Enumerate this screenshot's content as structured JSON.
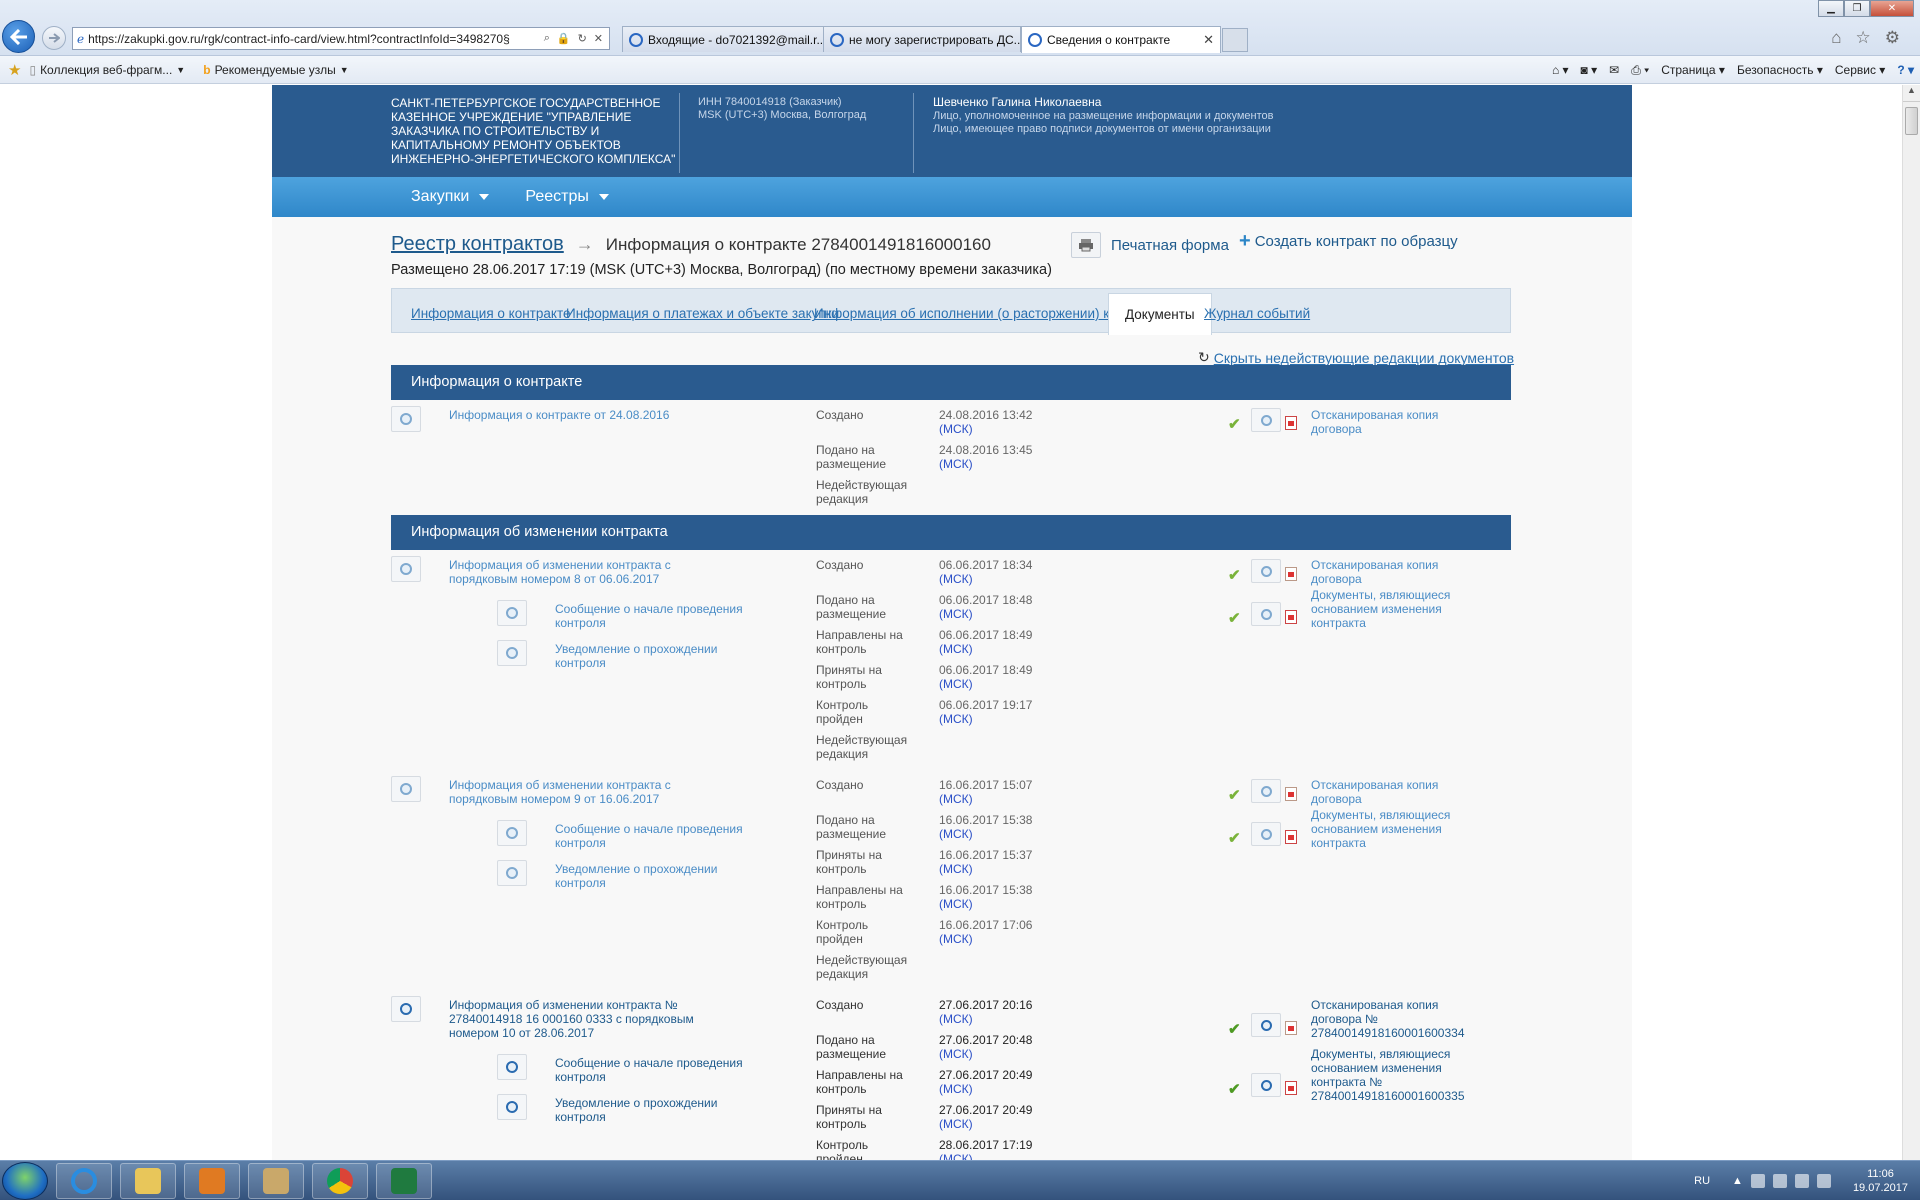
{
  "browser": {
    "address": "https://zakupki.gov.ru/rgk/contract-info-card/view.html?contractInfoId=3498270§",
    "tabs": [
      {
        "label": "Входящие - do7021392@mail.r..."
      },
      {
        "label": "не могу зарегистрировать ДС..."
      },
      {
        "label": "Сведения о контракте"
      }
    ],
    "favorites": {
      "collection": "Коллекция веб-фрагм...",
      "recommended": "Рекомендуемые узлы"
    },
    "commands": {
      "page": "Страница",
      "security": "Безопасность",
      "service": "Сервис"
    }
  },
  "header": {
    "org_name": "САНКТ-ПЕТЕРБУРГСКОЕ ГОСУДАРСТВЕННОЕ КАЗЕННОЕ УЧРЕЖДЕНИЕ \"УПРАВЛЕНИЕ ЗАКАЗЧИКА ПО СТРОИТЕЛЬСТВУ И КАПИТАЛЬНОМУ РЕМОНТУ ОБЪЕКТОВ ИНЖЕНЕРНО-ЭНЕРГЕТИЧЕСКОГО КОМПЛЕКСА\"",
    "inn": "ИНН 7840014918 (Заказчик)",
    "timezone": "MSK (UTC+3) Москва, Волгоград",
    "user_name": "Шевченко Галина Николаевна",
    "role1": "Лицо, уполномоченное на размещение информации и документов",
    "role2": "Лицо, имеющее право подписи документов от имени организации"
  },
  "menu": {
    "purchases": "Закупки",
    "registries": "Реестры"
  },
  "breadcrumb": {
    "link": "Реестр контрактов",
    "current": "Информация о контракте 2784001491816000160"
  },
  "actions": {
    "print": "Печатная форма",
    "create": "Создать контракт по образцу"
  },
  "placed": "Размещено 28.06.2017 17:19 (MSK (UTC+3) Москва, Волгоград) (по местному времени заказчика)",
  "page_tabs": {
    "info": "Информация о контракте",
    "payments": "Информация о платежах и объекте закупки",
    "execution": "Информация об исполнении (о расторжении) контракта",
    "documents": "Документы",
    "journal": "Журнал событий"
  },
  "hide_link": "Скрыть недействующие редакции документов",
  "msk": "(МСК)",
  "sections": {
    "contract_info": "Информация о контракте",
    "changes": "Информация об изменении контракта"
  },
  "labels": {
    "created": "Создано",
    "submitted": "Подано на размещение",
    "sent_control": "Направлены на контроль",
    "accepted_control": "Приняты на контроль",
    "control_passed": "Контроль пройден",
    "inactive": "Недействующая редакция"
  },
  "docs": {
    "d1": {
      "title": "Информация о контракте от 24.08.2016",
      "created": "24.08.2016 13:42",
      "submitted": "24.08.2016 13:45",
      "att1": "Отсканированая копия договора"
    },
    "d2": {
      "title": "Информация об изменении контракта с порядковым номером 8 от 06.06.2017",
      "sub1": "Сообщение о начале проведения контроля",
      "sub2": "Уведомление о прохождении контроля",
      "created": "06.06.2017 18:34",
      "submitted": "06.06.2017 18:48",
      "sent": "06.06.2017 18:49",
      "accepted": "06.06.2017 18:49",
      "passed": "06.06.2017 19:17",
      "att1": "Отсканированая копия договора",
      "att2": "Документы, являющиеся основанием изменения контракта"
    },
    "d3": {
      "title": "Информация об изменении контракта с порядковым номером 9 от 16.06.2017",
      "sub1": "Сообщение о начале проведения контроля",
      "sub2": "Уведомление о прохождении контроля",
      "created": "16.06.2017 15:07",
      "submitted": "16.06.2017 15:38",
      "accepted": "16.06.2017 15:37",
      "sent": "16.06.2017 15:38",
      "passed": "16.06.2017 17:06",
      "att1": "Отсканированая копия договора",
      "att2": "Документы, являющиеся основанием изменения контракта"
    },
    "d4": {
      "title": "Информация об изменении контракта № 27840014918 16 000160 0333 с порядковым номером 10 от 28.06.2017",
      "sub1": "Сообщение о начале проведения контроля",
      "sub2": "Уведомление о прохождении контроля",
      "created": "27.06.2017 20:16",
      "submitted": "27.06.2017 20:48",
      "sent": "27.06.2017 20:49",
      "accepted": "27.06.2017 20:49",
      "passed": "28.06.2017 17:19",
      "att1": "Отсканированая копия договора № 27840014918160001600334",
      "att2": "Документы, являющиеся основанием изменения контракта № 27840014918160001600335"
    }
  },
  "taskbar": {
    "lang": "RU",
    "time": "11:06",
    "date": "19.07.2017"
  }
}
